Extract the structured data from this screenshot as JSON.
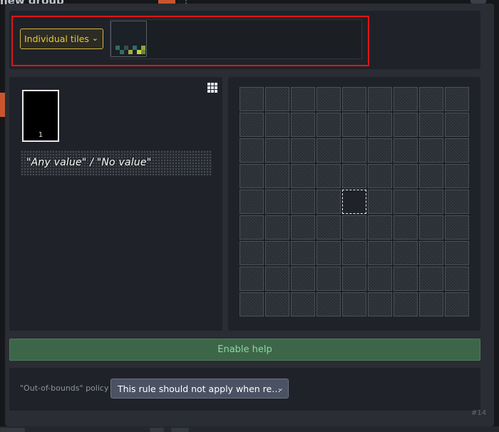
{
  "background": {
    "title": "new group",
    "menu_icon": "more-dots-icon"
  },
  "dialog": {
    "mode_select": {
      "value": "Individual tiles",
      "icon": "chevron-down-icon"
    },
    "tile_thumb": {
      "label": "tile-group-preview"
    },
    "grid_toggle_icon": "grid-icon",
    "value_card": {
      "number": "1"
    },
    "any_value_text": "\"Any value\" / \"No value\"",
    "help_button": "Enable help",
    "out_of_bounds": {
      "label": "\"Out-of-bounds\" policy",
      "value": "This rule should not apply when re…",
      "icon": "chevron-down-icon"
    },
    "id_tag": "#14"
  },
  "colors": {
    "accent_yellow": "#f0c830",
    "highlight_red": "#e01515",
    "help_green": "#3d6648",
    "panel": "#1f2228",
    "dialog_bg": "#2a2d33"
  }
}
